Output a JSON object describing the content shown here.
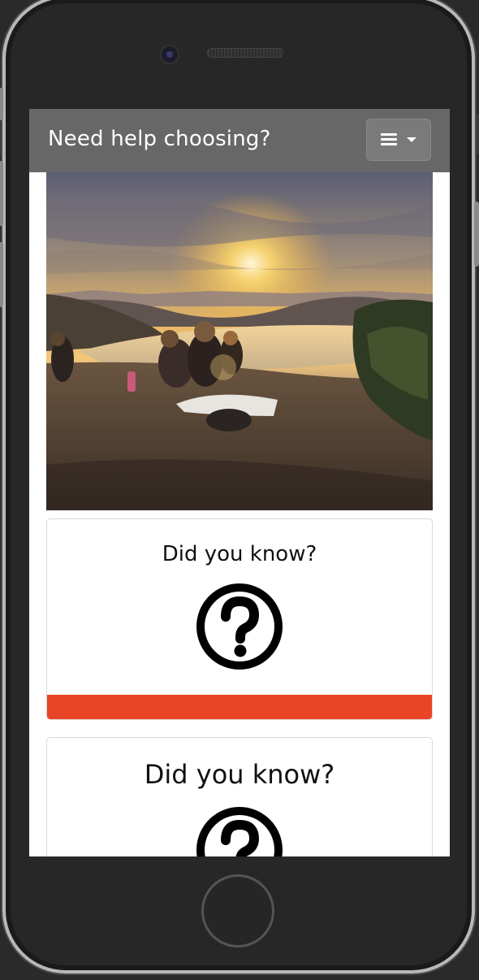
{
  "navbar": {
    "brand": "Need help choosing?",
    "toggler_icon": "menu-bars-icon"
  },
  "hero": {
    "image_alt": "sunset-hilltop-photo"
  },
  "cards": [
    {
      "title": "Did you know?",
      "icon": "question-circle-icon",
      "bar_color": "#ea4426"
    },
    {
      "title": "Did you know?",
      "icon": "question-circle-icon"
    }
  ],
  "colors": {
    "navbar_bg": "#5a5a5a",
    "accent": "#ea4426",
    "device": "#272727"
  }
}
